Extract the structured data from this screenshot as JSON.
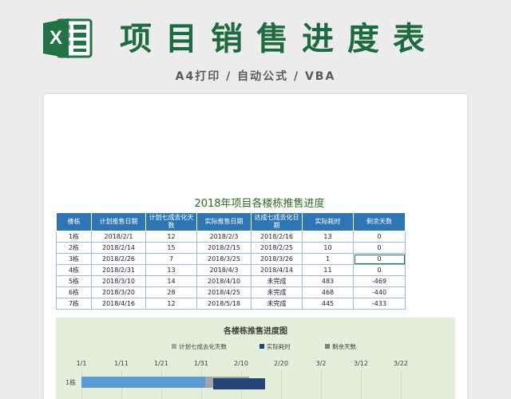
{
  "header": {
    "title": "项目销售进度表",
    "subtitle": "A4打印 / 自动公式 / VBA",
    "icon": "excel-icon",
    "icon_letter": "X",
    "brand_color": "#217346"
  },
  "sheet": {
    "title": "2018年项目各楼栋推售进度",
    "table": {
      "headers": [
        "楼栋",
        "计划推售日期",
        "计划七成去化天数",
        "实际推售日期",
        "达成七成去化日期",
        "实际耗时",
        "剩余天数"
      ],
      "rows": [
        [
          "1栋",
          "2018/2/1",
          "12",
          "2018/2/3",
          "2018/2/16",
          "13",
          "0"
        ],
        [
          "2栋",
          "2018/2/14",
          "15",
          "2018/2/15",
          "2018/2/25",
          "10",
          "0"
        ],
        [
          "3栋",
          "2018/2/26",
          "7",
          "2018/3/25",
          "2018/3/26",
          "1",
          "0"
        ],
        [
          "4栋",
          "2018/2/31",
          "13",
          "2018/4/3",
          "2018/4/14",
          "11",
          "0"
        ],
        [
          "5栋",
          "2018/3/10",
          "14",
          "2018/4/10",
          "未完成",
          "483",
          "-469"
        ],
        [
          "6栋",
          "2018/3/20",
          "28",
          "2018/4/25",
          "未完成",
          "468",
          "-440"
        ],
        [
          "7栋",
          "2018/4/16",
          "12",
          "2018/5/18",
          "未完成",
          "445",
          "-433"
        ]
      ]
    }
  },
  "chart_data": {
    "type": "bar",
    "title": "各楼栋推售进度图",
    "legend": [
      "计划七成去化天数",
      "实际耗时",
      "剩余天数"
    ],
    "legend_position": "top",
    "x_ticks": [
      "1/1",
      "1/11",
      "1/21",
      "1/31",
      "2/10",
      "2/20",
      "3/2",
      "3/12",
      "3/22"
    ],
    "colors": {
      "planned": "#5b9bd5",
      "actual": "#264478",
      "remaining": "#a5a5a5"
    },
    "visible_categories": [
      "1栋"
    ],
    "series": [
      {
        "name": "计划七成去化天数",
        "bars": [
          {
            "start": "1/1",
            "end": "2/1"
          }
        ]
      },
      {
        "name": "实际耗时",
        "bars": [
          {
            "start": "2/3",
            "end": "2/16"
          }
        ]
      },
      {
        "name": "剩余天数",
        "bars": [
          {
            "start": "2/1",
            "end": "2/12"
          }
        ]
      }
    ],
    "x_range": [
      "1/1",
      "3/31"
    ],
    "grid": true
  }
}
